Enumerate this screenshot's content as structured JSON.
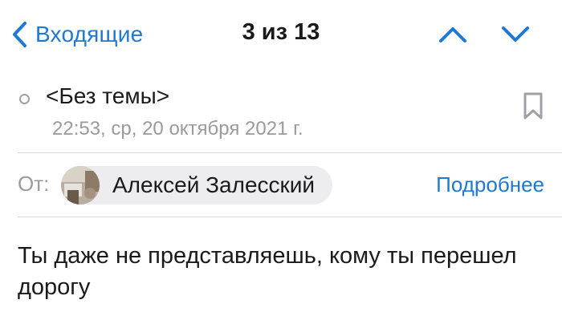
{
  "nav": {
    "back_label": "Входящие",
    "title": "3 из 13"
  },
  "message": {
    "subject": "<Без темы>",
    "date": "22:53, ср, 20 октября 2021 г.",
    "from_label": "От:",
    "sender_name": "Алексей Залесский",
    "details_label": "Подробнее",
    "body": "Ты даже не представляешь, кому ты перешел дорогу"
  },
  "icons": {
    "back": "chevron-left-icon",
    "prev": "chevron-up-icon",
    "next": "chevron-down-icon",
    "unread": "unread-dot-icon",
    "bookmark": "bookmark-icon"
  },
  "colors": {
    "accent": "#1f78d1",
    "secondary_text": "#9a9a9f",
    "chip_background": "#ededf0",
    "divider": "#d8d8dc"
  }
}
